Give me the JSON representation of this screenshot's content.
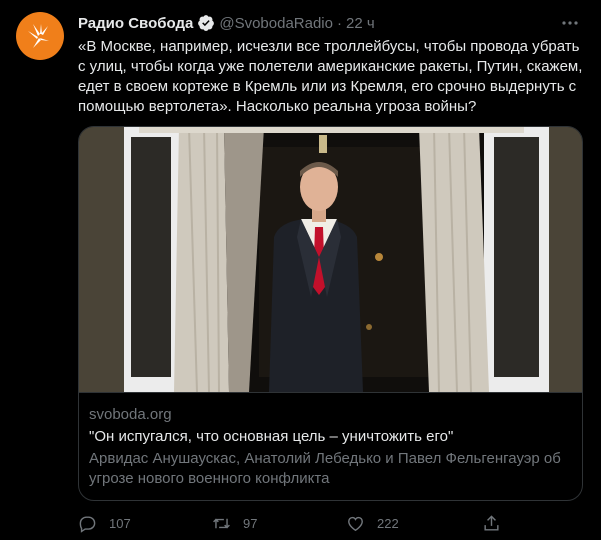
{
  "tweet": {
    "author": "Радио Свобода",
    "handle": "@SvobodaRadio",
    "separator": "·",
    "time": "22 ч",
    "text": "«В Москве, например, исчезли все троллейбусы, чтобы провода убрать с улиц, чтобы когда уже полетели американские ракеты, Путин, скажем, едет в своем кортеже в Кремль или из Кремля, его срочно выдернуть с помощью вертолета». Насколько реальна угроза войны?"
  },
  "card": {
    "domain": "svoboda.org",
    "title": "\"Он испугался, что основная цель – уничтожить его\"",
    "description": "Арвидас Анушаускас, Анатолий Лебедько и Павел Фельгенгауэр об угрозе нового военного конфликта"
  },
  "actions": {
    "replies": "107",
    "retweets": "97",
    "likes": "222"
  },
  "colors": {
    "background": "#000000",
    "avatar": "#f07f1a",
    "verified": "#1d9bf0",
    "secondary_text": "#71767b"
  }
}
